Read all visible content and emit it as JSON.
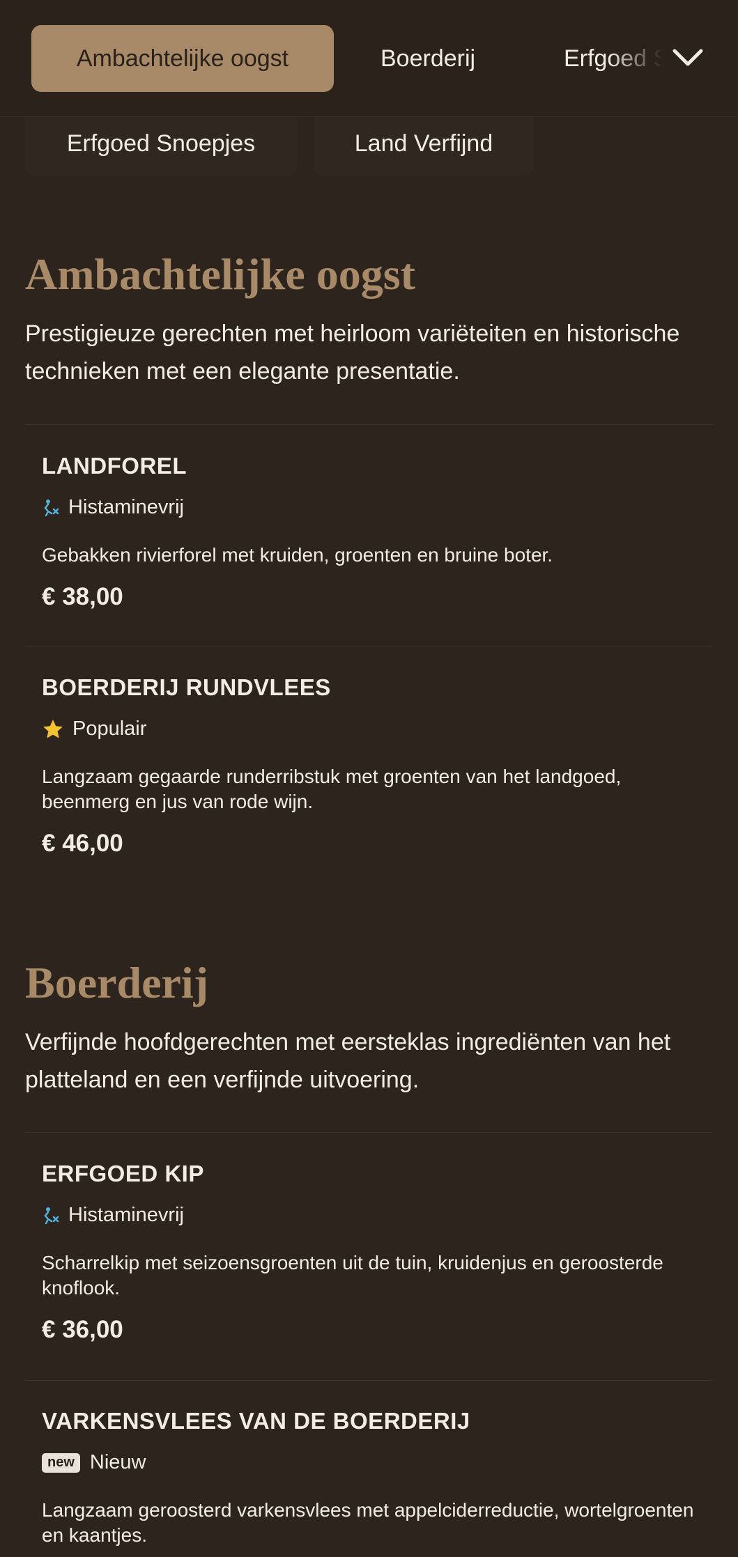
{
  "nav": {
    "tabs": [
      {
        "label": "Ambachtelijke oogst",
        "active": true
      },
      {
        "label": "Boerderij",
        "active": false
      },
      {
        "label": "Erfgoed Snoepjes",
        "active": false
      }
    ],
    "expand_icon": "chevron-down-icon"
  },
  "subnav": {
    "pills": [
      {
        "label": "Erfgoed Snoepjes"
      },
      {
        "label": "Land Verfijnd"
      }
    ]
  },
  "sections": [
    {
      "title": "Ambachtelijke oogst",
      "description": "Prestigieuze gerechten met heirloom variëteiten en historische technieken met een elegante presentatie.",
      "items": [
        {
          "name": "LANDFOREL",
          "badge": {
            "icon": "histamine-free-icon",
            "label": "Histaminevrij"
          },
          "description": "Gebakken rivierforel met kruiden, groenten en bruine boter.",
          "price": "€ 38,00"
        },
        {
          "name": "BOERDERIJ RUNDVLEES",
          "badge": {
            "icon": "star-icon",
            "label": "Populair"
          },
          "description": "Langzaam gegaarde runderribstuk met groenten van het landgoed, beenmerg en jus van rode wijn.",
          "price": "€ 46,00"
        }
      ]
    },
    {
      "title": "Boerderij",
      "description": "Verfijnde hoofdgerechten met eersteklas ingrediënten van het platteland en een verfijnde uitvoering.",
      "items": [
        {
          "name": "ERFGOED KIP",
          "badge": {
            "icon": "histamine-free-icon",
            "label": "Histaminevrij"
          },
          "description": "Scharrelkip met seizoensgroenten uit de tuin, kruidenjus en geroosterde knoflook.",
          "price": "€ 36,00"
        },
        {
          "name": "VARKENSVLEES VAN DE BOERDERIJ",
          "badge": {
            "icon": "new-badge-icon",
            "tag": "new",
            "label": "Nieuw"
          },
          "description": "Langzaam geroosterd varkensvlees met appelciderreductie, wortelgroenten en kaantjes."
        }
      ]
    }
  ],
  "colors": {
    "background": "#2c241d",
    "accent": "#a98a68",
    "text": "#f3ece3",
    "star": "#f2c230",
    "histamine_icon": "#4fb3e0"
  }
}
